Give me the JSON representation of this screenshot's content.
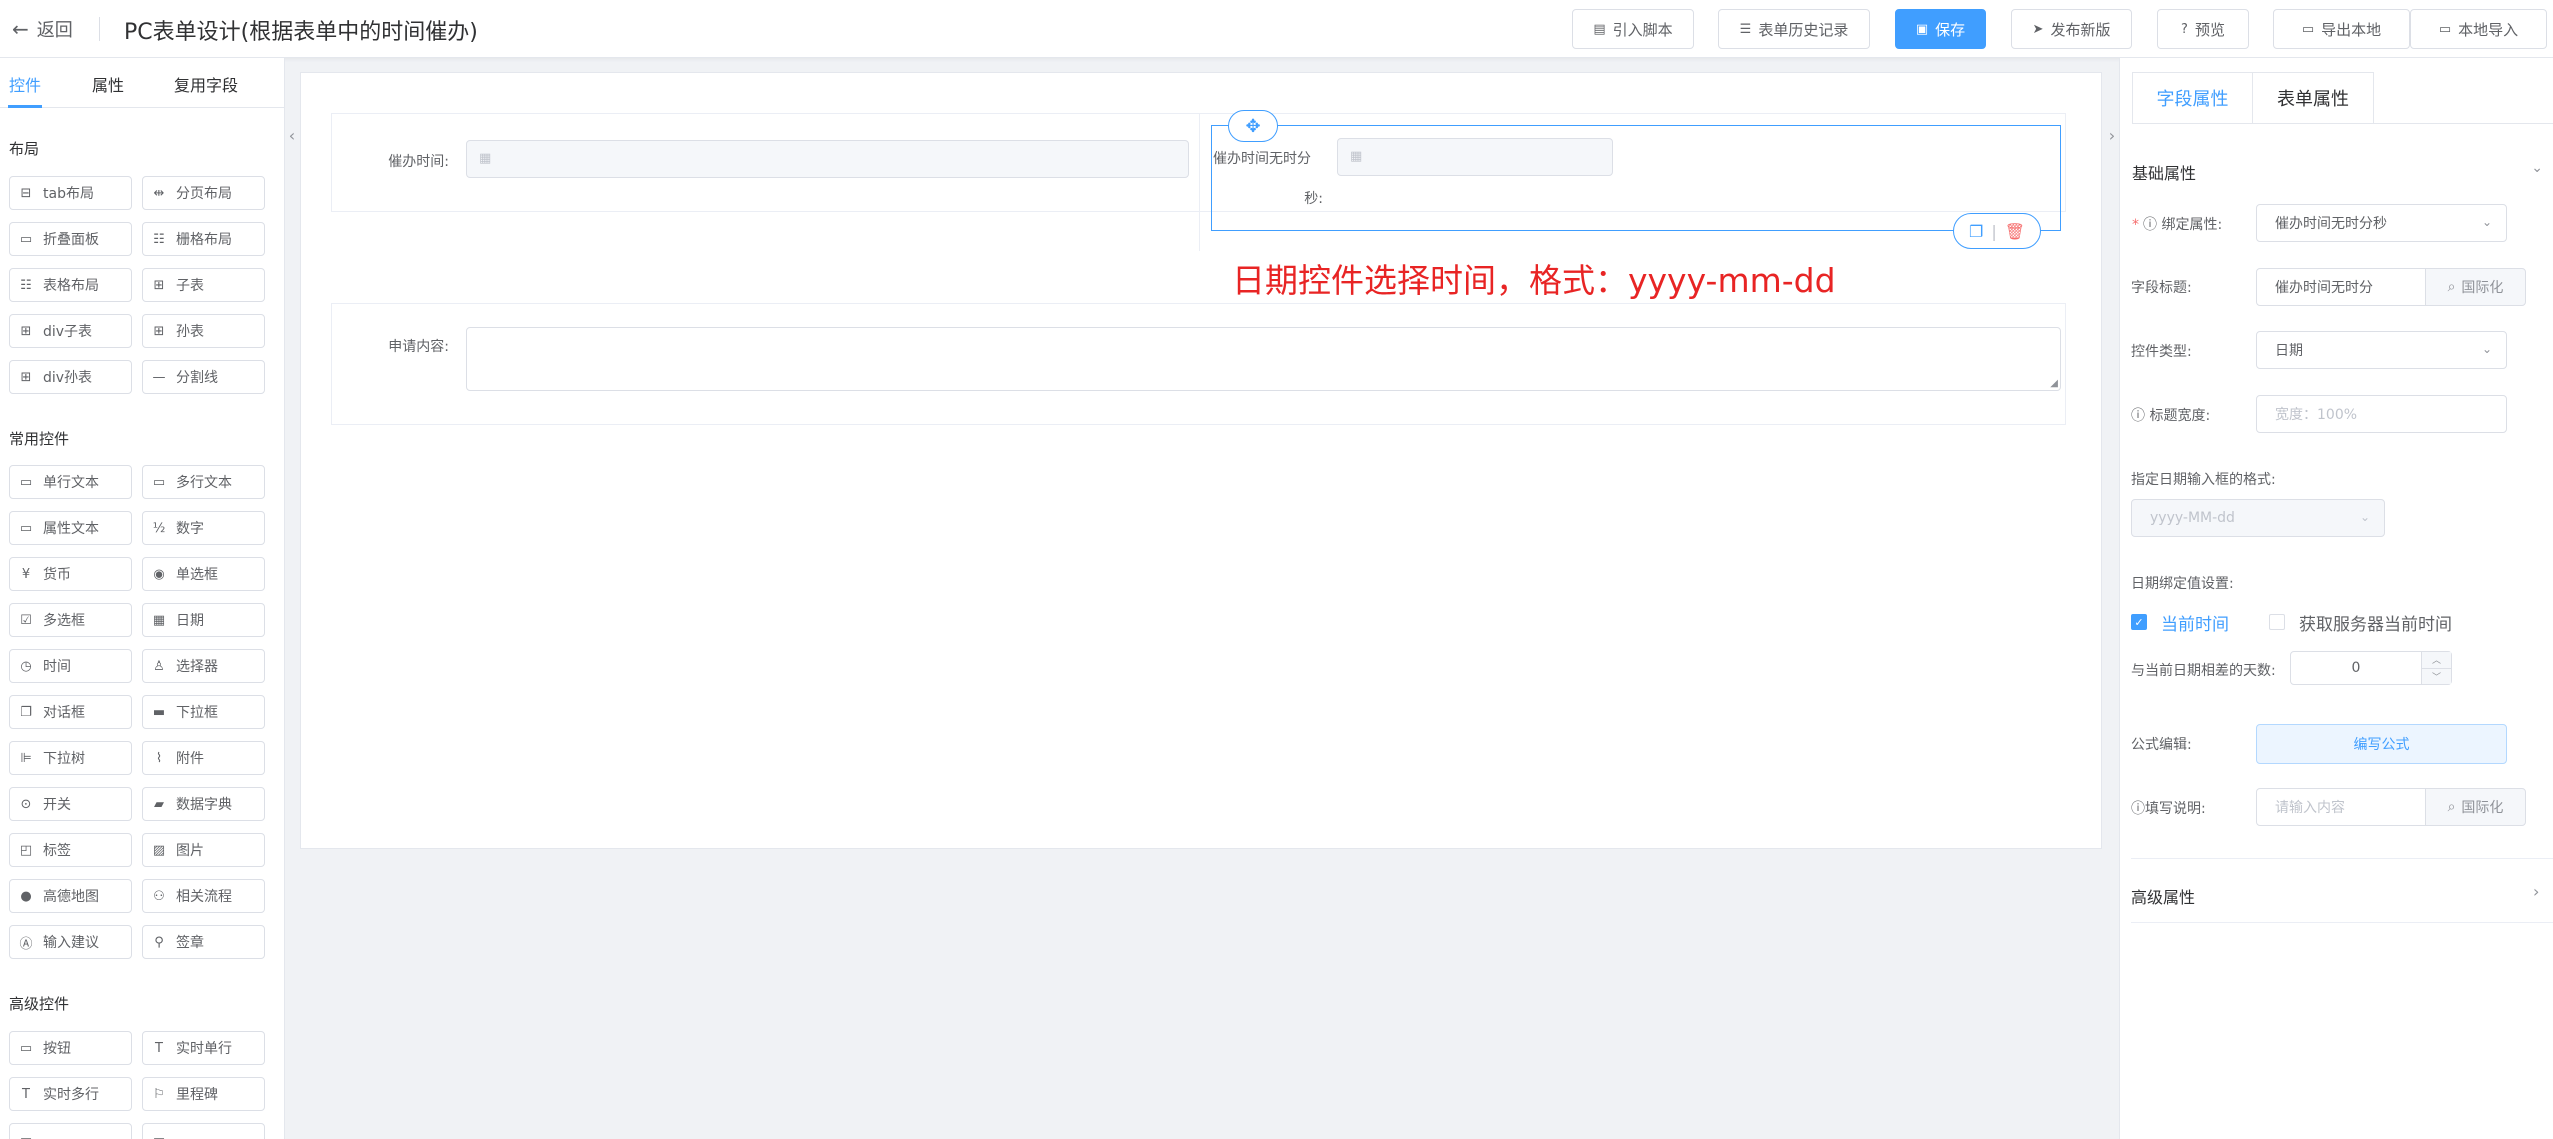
{
  "header": {
    "back_label": "返回",
    "title": "PC表单设计(根据表单中的时间催办)",
    "buttons": {
      "import_script": "引入脚本",
      "history": "表单历史记录",
      "save": "保存",
      "publish": "发布新版",
      "preview": "预览",
      "export_local": "导出本地",
      "import_local": "本地导入"
    }
  },
  "left_panel": {
    "tabs": [
      "控件",
      "属性",
      "复用字段"
    ],
    "sections": {
      "layout": {
        "title": "布局",
        "items": [
          "tab布局",
          "分页布局",
          "折叠面板",
          "栅格布局",
          "表格布局",
          "子表",
          "div子表",
          "孙表",
          "div孙表",
          "分割线"
        ]
      },
      "common": {
        "title": "常用控件",
        "items": [
          "单行文本",
          "多行文本",
          "属性文本",
          "数字",
          "货币",
          "单选框",
          "多选框",
          "日期",
          "时间",
          "选择器",
          "对话框",
          "下拉框",
          "下拉树",
          "附件",
          "开关",
          "数据字典",
          "标签",
          "图片",
          "高德地图",
          "相关流程",
          "输入建议",
          "签章"
        ]
      },
      "advanced": {
        "title": "高级控件",
        "items": [
          "按钮",
          "实时单行",
          "实时多行",
          "里程碑"
        ]
      }
    }
  },
  "canvas": {
    "fields": {
      "urge_time_label": "催办时间:",
      "urge_time_no_hms_label_1": "催办时间无时分",
      "urge_time_no_hms_label_2": "秒:",
      "apply_content_label": "申请内容:"
    },
    "annotation": "日期控件选择时间，格式：yyyy-mm-dd"
  },
  "right_panel": {
    "tabs": [
      "字段属性",
      "表单属性"
    ],
    "basic_section": "基础属性",
    "advanced_section": "高级属性",
    "bind_attr": {
      "label": "绑定属性:",
      "value": "催办时间无时分秒"
    },
    "field_title": {
      "label": "字段标题:",
      "value": "催办时间无时分",
      "addon": "国际化"
    },
    "control_type": {
      "label": "控件类型:",
      "value": "日期"
    },
    "title_width": {
      "label": "标题宽度:",
      "placeholder": "宽度：100%"
    },
    "date_format": {
      "label": "指定日期输入框的格式:",
      "value": "yyyy-MM-dd"
    },
    "date_bind": {
      "label": "日期绑定值设置:",
      "current_time": "当前时间",
      "server_time": "获取服务器当前时间",
      "current_time_checked": true,
      "server_time_checked": false
    },
    "day_diff": {
      "label": "与当前日期相差的天数:",
      "value": "0"
    },
    "formula": {
      "label": "公式编辑:",
      "button": "编写公式"
    },
    "fill_note": {
      "label": "填写说明:",
      "placeholder": "请输入内容",
      "addon": "国际化"
    }
  }
}
